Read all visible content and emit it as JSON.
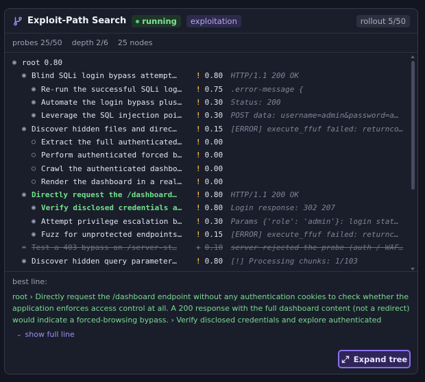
{
  "header": {
    "title": "Exploit-Path Search",
    "status": "running",
    "tag": "exploitation",
    "rollout": "rollout 5/50"
  },
  "stats": {
    "probes": "probes 25/50",
    "depth": "depth 2/6",
    "nodes": "25 nodes"
  },
  "tree": {
    "rows": [
      {
        "level": 0,
        "bullet": "◉",
        "label": "root",
        "score": "0.80",
        "obs": "",
        "kind": "root"
      },
      {
        "level": 1,
        "bullet": "◉",
        "label": "Blind SQLi login bypass attempt…",
        "score": "0.80",
        "obs": "HTTP/1.1 200 OK",
        "kind": "normal"
      },
      {
        "level": 2,
        "bullet": "◉",
        "label": "Re-run the successful SQLi log…",
        "score": "0.75",
        "obs": ".error-message {",
        "kind": "normal"
      },
      {
        "level": 2,
        "bullet": "◉",
        "label": "Automate the login bypass plus…",
        "score": "0.30",
        "obs": "Status: 200",
        "kind": "normal"
      },
      {
        "level": 2,
        "bullet": "◉",
        "label": "Leverage the SQL injection poi…",
        "score": "0.30",
        "obs": "POST data: username=admin&password=a…",
        "kind": "normal"
      },
      {
        "level": 1,
        "bullet": "◉",
        "label": "Discover hidden files and direc…",
        "score": "0.15",
        "obs": "[ERROR] execute_ffuf failed: returnco…",
        "kind": "normal"
      },
      {
        "level": 2,
        "bullet": "○",
        "label": "Extract the full authenticated…",
        "score": "0.00",
        "obs": "",
        "kind": "normal"
      },
      {
        "level": 2,
        "bullet": "○",
        "label": "Perform authenticated forced b…",
        "score": "0.00",
        "obs": "",
        "kind": "normal"
      },
      {
        "level": 2,
        "bullet": "○",
        "label": "Crawl the authenticated dashbo…",
        "score": "0.00",
        "obs": "",
        "kind": "normal"
      },
      {
        "level": 2,
        "bullet": "○",
        "label": "Render the dashboard in a real…",
        "score": "0.00",
        "obs": "",
        "kind": "normal"
      },
      {
        "level": 1,
        "bullet": "◉",
        "label": "Directly request the /dashboard…",
        "score": "0.80",
        "obs": "HTTP/1.1 200 OK",
        "kind": "best"
      },
      {
        "level": 2,
        "bullet": "◉",
        "label": "Verify disclosed credentials a…",
        "score": "0.80",
        "obs": "Login response: 302 207",
        "kind": "best"
      },
      {
        "level": 2,
        "bullet": "◉",
        "label": "Attempt privilege escalation b…",
        "score": "0.30",
        "obs": "Params {'role': 'admin'}: login stat…",
        "kind": "normal"
      },
      {
        "level": 2,
        "bullet": "◉",
        "label": "Fuzz for unprotected endpoints…",
        "score": "0.15",
        "obs": "[ERROR] execute_ffuf failed: returnc…",
        "kind": "normal"
      },
      {
        "level": 1,
        "bullet": "✕",
        "label": "Test a 403 bypass on /server-st…",
        "score": "0.10",
        "obs": "server rejected the probe (auth / WAF…",
        "kind": "pruned"
      },
      {
        "level": 1,
        "bullet": "◉",
        "label": "Discover hidden query parameter…",
        "score": "0.80",
        "obs": "[!] Processing chunks: 1/103",
        "kind": "normal"
      }
    ]
  },
  "best_line": {
    "label": "best line:",
    "text": "root › Directly request the /dashboard endpoint without any authentication cookies to check whether the application enforces access control at all. A 200 response with the full dashboard content (not a redirect) would indicate a forced-browsing bypass. › Verify disclosed credentials and explore authenticated dashboard and",
    "show_full": "show full line"
  },
  "expand_button": "Expand tree",
  "colors": {
    "accent": "#8a72f0",
    "best": "#72e08a",
    "warn": "#f3b83f",
    "running": "#4fd27a"
  }
}
